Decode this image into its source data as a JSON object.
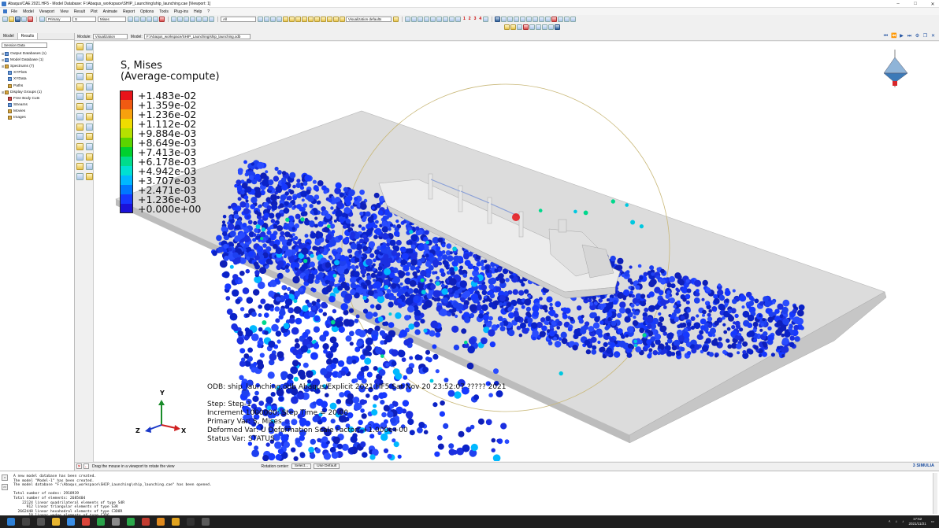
{
  "window": {
    "title": "Abaqus/CAE 2021.HF5 - Model Database: F:\\Abaqus_workspace\\SHIP_Launching\\ship_launching.cae [Viewport: 1]",
    "controls": [
      "–",
      "□",
      "✕"
    ]
  },
  "menu": [
    "File",
    "Model",
    "Viewport",
    "View",
    "Result",
    "Plot",
    "Animate",
    "Report",
    "Options",
    "Tools",
    "Plug-ins",
    "Help",
    "?"
  ],
  "toolbar": {
    "step_select": "Primary",
    "frame_select": "S",
    "variable_select": "Mises",
    "all_select": "All",
    "viz_defaults": "Visualization defaults",
    "numbers": [
      "1",
      "2",
      "3",
      "4"
    ]
  },
  "context": {
    "module_label": "Module:",
    "module_value": "Visualization",
    "model_label": "Model:",
    "model_value": "F:/Abaqus_workspace/SHIP_Launching/ship_launching.odb"
  },
  "left_panel": {
    "tabs": [
      "Model",
      "Results"
    ],
    "session_select": "Session Data",
    "tree": [
      {
        "label": "Output Databases (1)",
        "exp": "⊞",
        "icon": "blue",
        "child": false
      },
      {
        "label": "Model Database (1)",
        "exp": "⊞",
        "icon": "blue",
        "child": false
      },
      {
        "label": "Spectrums (7)",
        "exp": "⊞",
        "icon": "yellow",
        "child": false
      },
      {
        "label": "XYPlots",
        "exp": "",
        "icon": "blue",
        "child": true
      },
      {
        "label": "XYData",
        "exp": "",
        "icon": "blue",
        "child": true
      },
      {
        "label": "Paths",
        "exp": "",
        "icon": "yellow",
        "child": true
      },
      {
        "label": "Display Groups (1)",
        "exp": "⊞",
        "icon": "yellow",
        "child": false
      },
      {
        "label": "Free Body Cuts",
        "exp": "",
        "icon": "red",
        "child": true
      },
      {
        "label": "Streams",
        "exp": "",
        "icon": "blue",
        "child": true
      },
      {
        "label": "Movies",
        "exp": "",
        "icon": "yellow",
        "child": true
      },
      {
        "label": "Images",
        "exp": "",
        "icon": "yellow",
        "child": true
      }
    ]
  },
  "legend": {
    "title_line1": "S, Mises",
    "title_line2": "(Average-compute)",
    "entries": [
      {
        "label": "+1.483e-02",
        "color": "#e8141a"
      },
      {
        "label": "+1.359e-02",
        "color": "#f05a12"
      },
      {
        "label": "+1.236e-02",
        "color": "#f7a10e"
      },
      {
        "label": "+1.112e-02",
        "color": "#f0dc00"
      },
      {
        "label": "+9.884e-03",
        "color": "#b5e000"
      },
      {
        "label": "+8.649e-03",
        "color": "#5bd400"
      },
      {
        "label": "+7.413e-03",
        "color": "#00d02e"
      },
      {
        "label": "+6.178e-03",
        "color": "#00dc8c"
      },
      {
        "label": "+4.942e-03",
        "color": "#00e0d2"
      },
      {
        "label": "+3.707e-03",
        "color": "#00b8ff"
      },
      {
        "label": "+2.471e-03",
        "color": "#0078ff"
      },
      {
        "label": "+1.236e-03",
        "color": "#1638ff"
      },
      {
        "label": "+0.000e+00",
        "color": "#1b12d8"
      }
    ]
  },
  "odb_info": {
    "line1": "ODB: ship_launching.odb    Abaqus/Explicit 2021.HF5    Sat Nov 20 23:52:07 ????? 2021",
    "step_line": "Step: Step-1",
    "increment_line": "Increment  1000000: Step Time =    20.00",
    "primary_line": "Primary Var: S, Mises",
    "deformed_line": "Deformed Var: U   Deformation Scale Factor: +1.000e+00",
    "status_line": "Status Var: STATUS"
  },
  "triad": {
    "x": "X",
    "y": "Y",
    "z": "Z"
  },
  "prompt": {
    "text": "Drag the mouse in a viewport to rotate the view",
    "rotation_label": "Rotation center:",
    "select_button": "Select...",
    "default_button": "Use Default",
    "brand": "3 SIMULIA"
  },
  "messages": [
    "A new model database has been created.",
    "The model \"Model-1\" has been created.",
    "The model database \"F:\\Abaqus_workspace\\SHIP_Launching\\ship_launching.cae\" has been opened.",
    "",
    "Total number of nodes: 2918939",
    "Total number of elements: 2685404",
    "    22124 linear quadrilateral elements of type S4R",
    "      912 linear triangular elements of type S3R",
    "  2662448 linear hexahedral elements of type C3D8R",
    "       18 linear wedge elements of type C3D6"
  ],
  "taskbar": {
    "time": "17:52",
    "date": "2021/11/21"
  },
  "colors": {
    "accent": "#1a4c9e",
    "particle_blue": "#1b2fe0",
    "ship": "#e4e4e4",
    "ground": "#d2d2d2"
  }
}
